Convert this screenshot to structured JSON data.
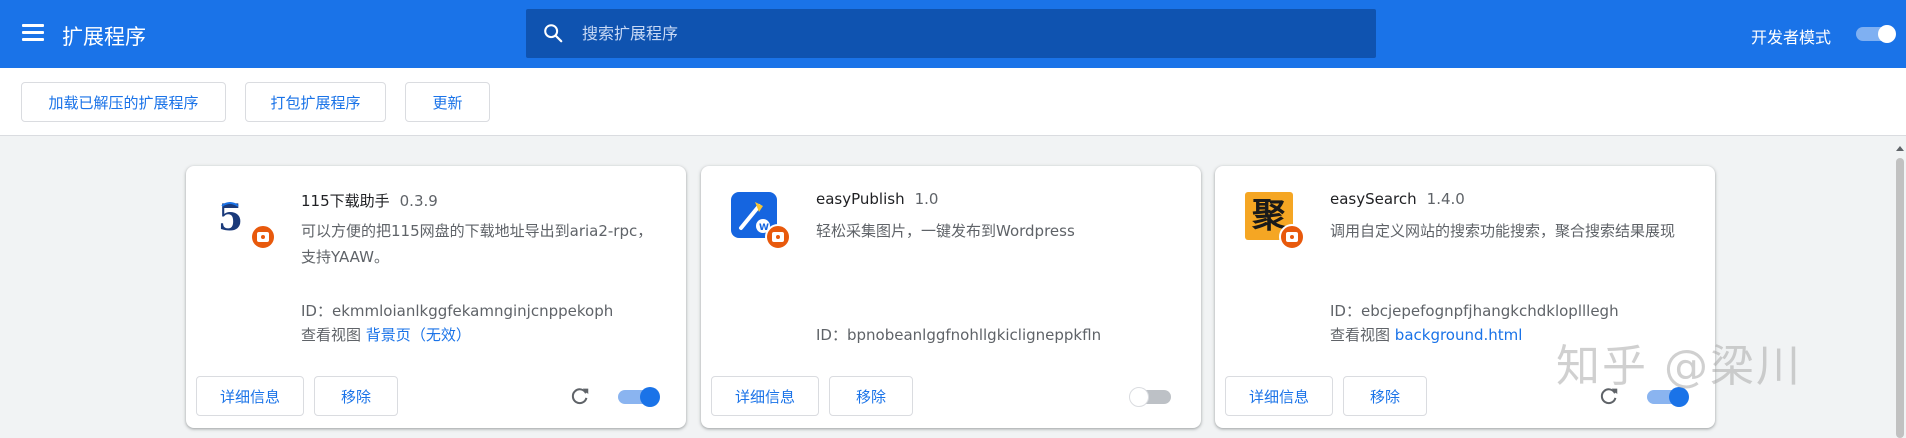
{
  "header": {
    "title": "扩展程序",
    "search_placeholder": "搜索扩展程序",
    "dev_mode_label": "开发者模式",
    "dev_mode_on": true
  },
  "toolbar": {
    "load_unpacked": "加载已解压的扩展程序",
    "pack_extension": "打包扩展程序",
    "update": "更新"
  },
  "extensions": [
    {
      "name": "115下载助手",
      "version": "0.3.9",
      "description": "可以方便的把115网盘的下载地址导出到aria2-rpc，支持YAAW。",
      "id_label": "ID：",
      "id": "ekmmloianlkggfekamnginjcnppekoph",
      "views_label": "查看视图",
      "views_link": "背景页",
      "views_suffix": "（无效）",
      "details_label": "详细信息",
      "remove_label": "移除",
      "enabled": true,
      "icon": "115-logo-icon"
    },
    {
      "name": "easyPublish",
      "version": "1.0",
      "description": "轻松采集图片，一键发布到Wordpress",
      "id_label": "ID：",
      "id": "bpnobeanlggfnohllgkicligneppkfln",
      "details_label": "详细信息",
      "remove_label": "移除",
      "enabled": false,
      "icon": "easypublish-logo-icon"
    },
    {
      "name": "easySearch",
      "version": "1.4.0",
      "description": "调用自定义网站的搜索功能搜索，聚合搜索结果展现",
      "id_label": "ID：",
      "id": "ebcjepefognpfjhangkchdkloplllegh",
      "views_label": "查看视图",
      "views_link": "background.html",
      "details_label": "详细信息",
      "remove_label": "移除",
      "enabled": true,
      "icon": "easysearch-logo-icon",
      "icon_char": "聚"
    }
  ],
  "watermark": "知乎 @梁川",
  "colors": {
    "header_bg": "#1a73e8",
    "search_bg": "#0f53b0",
    "link": "#1a73e8",
    "toggle_on": "#1a73e8",
    "toggle_off": "#bdc1c6"
  }
}
